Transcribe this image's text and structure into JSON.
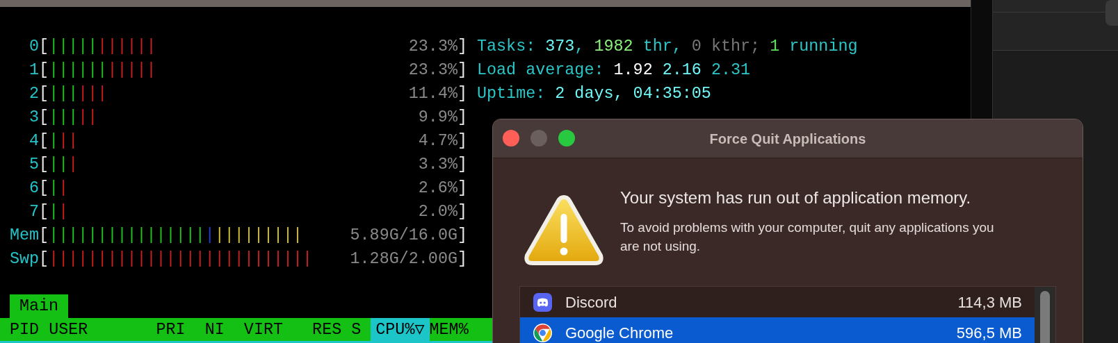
{
  "terminal": {
    "meters": [
      {
        "label": "0",
        "open": "[",
        "segments": [
          {
            "text": "|||||",
            "color": "#1fc41f"
          },
          {
            "text": "||||||",
            "color": "#cc1f1f"
          }
        ],
        "value": "23.3%",
        "close": "]"
      },
      {
        "label": "1",
        "open": "[",
        "segments": [
          {
            "text": "||||||",
            "color": "#1fc41f"
          },
          {
            "text": "|||||",
            "color": "#cc1f1f"
          }
        ],
        "value": "23.3%",
        "close": "]"
      },
      {
        "label": "2",
        "open": "[",
        "segments": [
          {
            "text": "|||",
            "color": "#1fc41f"
          },
          {
            "text": "|||",
            "color": "#cc1f1f"
          }
        ],
        "value": "11.4%",
        "close": "]"
      },
      {
        "label": "3",
        "open": "[",
        "segments": [
          {
            "text": "|||",
            "color": "#1fc41f"
          },
          {
            "text": "||",
            "color": "#cc1f1f"
          }
        ],
        "value": "9.9%",
        "close": "]"
      },
      {
        "label": "4",
        "open": "[",
        "segments": [
          {
            "text": "|",
            "color": "#1fc41f"
          },
          {
            "text": "||",
            "color": "#cc1f1f"
          }
        ],
        "value": "4.7%",
        "close": "]"
      },
      {
        "label": "5",
        "open": "[",
        "segments": [
          {
            "text": "||",
            "color": "#1fc41f"
          },
          {
            "text": "|",
            "color": "#cc1f1f"
          }
        ],
        "value": "3.3%",
        "close": "]"
      },
      {
        "label": "6",
        "open": "[",
        "segments": [
          {
            "text": "|",
            "color": "#1fc41f"
          },
          {
            "text": "|",
            "color": "#cc1f1f"
          }
        ],
        "value": "2.6%",
        "close": "]"
      },
      {
        "label": "7",
        "open": "[",
        "segments": [
          {
            "text": "|",
            "color": "#1fc41f"
          },
          {
            "text": "|",
            "color": "#cc1f1f"
          }
        ],
        "value": "2.0%",
        "close": "]"
      },
      {
        "label": "Mem",
        "open": "[",
        "segments": [
          {
            "text": "||||||||||||||||",
            "color": "#1fc41f"
          },
          {
            "text": "|",
            "color": "#1f3fd6"
          },
          {
            "text": "|||||||||",
            "color": "#d8c414"
          }
        ],
        "value": "5.89G/16.0G",
        "close": "]"
      },
      {
        "label": "Swp",
        "open": "[",
        "segments": [
          {
            "text": "|||||||||||||||||||||||||||",
            "color": "#cc1f1f"
          }
        ],
        "value": "1.28G/2.00G",
        "close": "]"
      }
    ],
    "info": [
      {
        "segments": [
          {
            "text": "Tasks: ",
            "color": "#2cc6c8"
          },
          {
            "text": "373",
            "color": "#6ff6f6"
          },
          {
            "text": ", ",
            "color": "#2cc6c8"
          },
          {
            "text": "1982",
            "color": "#8af27a"
          },
          {
            "text": " thr, ",
            "color": "#2cc6c8"
          },
          {
            "text": "0",
            "color": "#777777"
          },
          {
            "text": " kthr; ",
            "color": "#777777"
          },
          {
            "text": "1",
            "color": "#5fe05f"
          },
          {
            "text": " running",
            "color": "#2cc6c8"
          }
        ]
      },
      {
        "segments": [
          {
            "text": "Load average: ",
            "color": "#2cc6c8"
          },
          {
            "text": "1.92 ",
            "color": "#ffffff"
          },
          {
            "text": "2.16 ",
            "color": "#6ff6f6"
          },
          {
            "text": "2.31",
            "color": "#2cc6c8"
          }
        ]
      },
      {
        "segments": [
          {
            "text": "Uptime: ",
            "color": "#2cc6c8"
          },
          {
            "text": "2 days, 04:35:05",
            "color": "#6ff6f6"
          }
        ]
      }
    ],
    "tabs": [
      {
        "label": "Main",
        "selected": true
      }
    ],
    "columns": [
      {
        "label": "PID",
        "selected": false
      },
      {
        "label": "USER",
        "selected": false
      },
      {
        "label": "PRI",
        "selected": false
      },
      {
        "label": "NI",
        "selected": false
      },
      {
        "label": "VIRT",
        "selected": false
      },
      {
        "label": "RES",
        "selected": false
      },
      {
        "label": "S",
        "selected": false
      },
      {
        "label": "CPU%▽",
        "selected": true
      },
      {
        "label": "MEM%",
        "selected": false
      }
    ]
  },
  "dialog": {
    "title": "Force Quit Applications",
    "heading": "Your system has run out of application memory.",
    "message": "To avoid problems with your computer, quit any applications you are not using.",
    "apps": [
      {
        "kind": "chat",
        "name": "Discord",
        "memory": "114,3 MB",
        "selected": false
      },
      {
        "kind": "browser",
        "name": "Google Chrome",
        "memory": "596,5 MB",
        "selected": true
      }
    ]
  }
}
